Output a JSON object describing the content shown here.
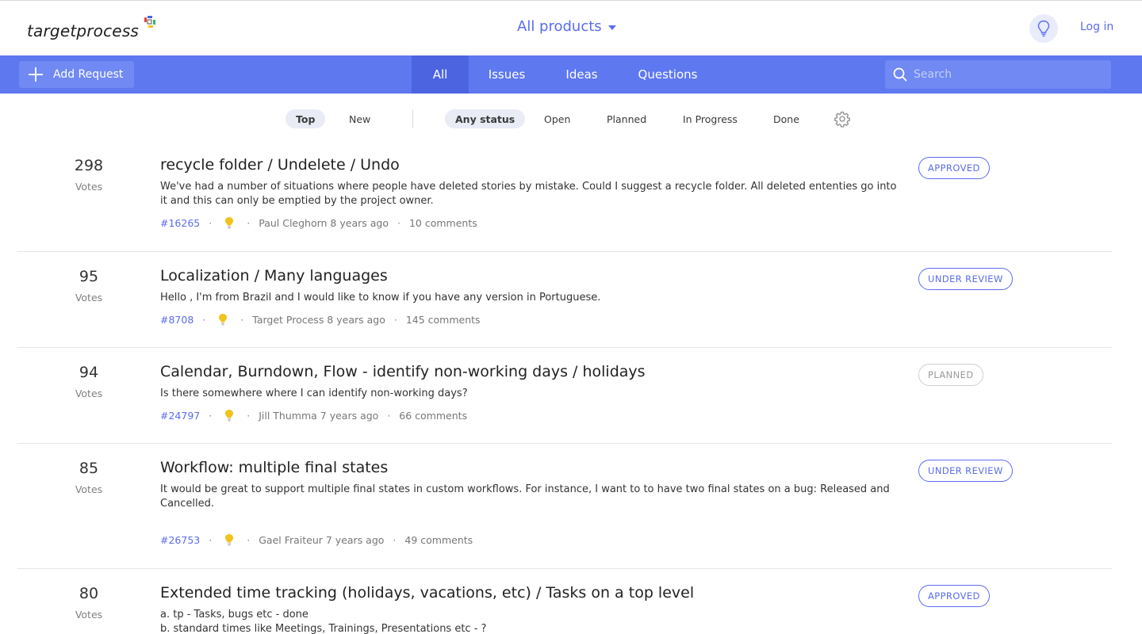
{
  "header": {
    "logo_text": "targetprocess",
    "products_label": "All products",
    "login_label": "Log in"
  },
  "navbar": {
    "add_request_label": "Add Request",
    "tabs": [
      {
        "label": "All",
        "active": true
      },
      {
        "label": "Issues",
        "active": false
      },
      {
        "label": "Ideas",
        "active": false
      },
      {
        "label": "Questions",
        "active": false
      }
    ],
    "search_placeholder": "Search"
  },
  "filters": {
    "sort": [
      {
        "label": "Top",
        "selected": true
      },
      {
        "label": "New",
        "selected": false
      }
    ],
    "status": [
      {
        "label": "Any status",
        "selected": true
      },
      {
        "label": "Open",
        "selected": false
      },
      {
        "label": "Planned",
        "selected": false
      },
      {
        "label": "In Progress",
        "selected": false
      },
      {
        "label": "Done",
        "selected": false
      }
    ]
  },
  "colors": {
    "accent": "#5b6cf0",
    "navbar": "#5e78f0",
    "navbar_active": "#4c64e0",
    "bulb": "#f2c21d"
  },
  "requests": [
    {
      "votes": "298",
      "votes_label": "Votes",
      "title": "recycle folder / Undelete / Undo",
      "description": "We've had a number of situations where people have deleted stories by mistake. Could I suggest a recycle folder. All deleted ententies go into it and this can only be emptied by the project owner.",
      "id": "#16265",
      "author_time": "Paul Cleghorn 8 years ago",
      "comments": "10 comments",
      "status": "APPROVED"
    },
    {
      "votes": "95",
      "votes_label": "Votes",
      "title": "Localization / Many languages",
      "description": "Hello , I'm from Brazil and I would like to know if you have any version in Portuguese.",
      "id": "#8708",
      "author_time": "Target Process 8 years ago",
      "comments": "145 comments",
      "status": "UNDER REVIEW"
    },
    {
      "votes": "94",
      "votes_label": "Votes",
      "title": "Calendar, Burndown, Flow - identify non-working days / holidays",
      "description": "Is there somewhere where I can identify non-working days?",
      "id": "#24797",
      "author_time": "Jill Thumma 7 years ago",
      "comments": "66 comments",
      "status": "PLANNED"
    },
    {
      "votes": "85",
      "votes_label": "Votes",
      "title": "Workflow: multiple final states",
      "description": "It would be great to support multiple final states in custom workflows. For instance, I want to to have two final states on a bug: Released and Cancelled.",
      "id": "#26753",
      "author_time": "Gael Fraiteur 7 years ago",
      "comments": "49 comments",
      "status": "UNDER REVIEW"
    },
    {
      "votes": "80",
      "votes_label": "Votes",
      "title": "Extended time tracking (holidays, vacations, etc) / Tasks on a top level",
      "description_lines": [
        "a. tp - Tasks, bugs etc - done",
        "b. standard times like Meetings, Trainings, Presentations etc - ?"
      ],
      "status": "APPROVED"
    }
  ]
}
